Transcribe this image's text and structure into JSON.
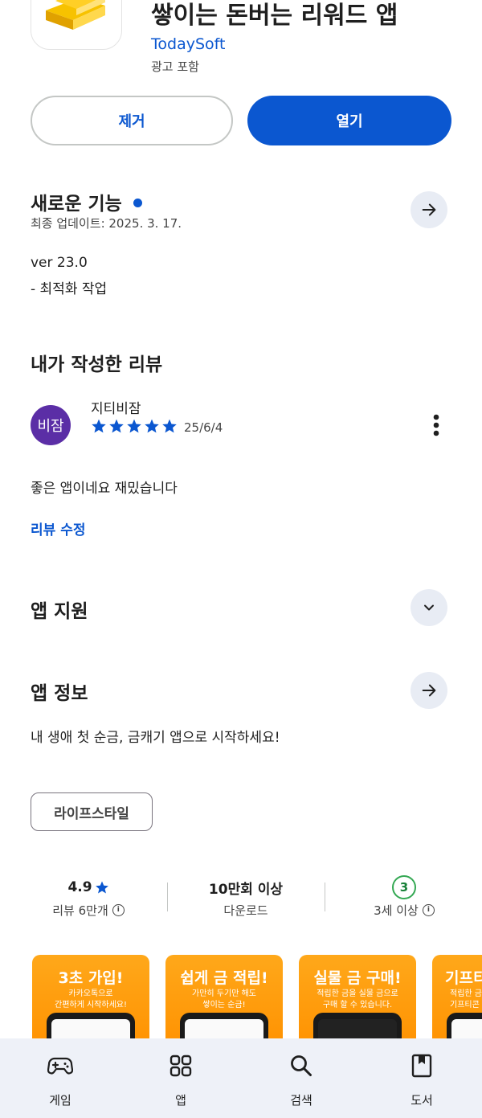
{
  "app": {
    "title": "쌓이는 돈버는 리워드 앱",
    "developer": "TodaySoft",
    "ads_note": "광고 포함",
    "remove_label": "제거",
    "open_label": "열기"
  },
  "whats_new": {
    "title": "새로운 기능",
    "updated": "최종 업데이트: 2025. 3. 17.",
    "version": "ver 23.0",
    "notes": "- 최적화 작업"
  },
  "my_review": {
    "section_title": "내가 작성한 리뷰",
    "avatar_text": "비잠",
    "reviewer": "지티비잠",
    "stars": 5,
    "date": "25/6/4",
    "text": "좋은 앱이네요 재밌습니다",
    "edit_label": "리뷰 수정"
  },
  "app_support": {
    "title": "앱 지원"
  },
  "app_info": {
    "title": "앱 정보",
    "description": "내 생애 첫 순금, 금캐기 앱으로 시작하세요!",
    "category_chip": "라이프스타일"
  },
  "stats": {
    "rating_value": "4.9",
    "rating_label": "리뷰 6만개",
    "downloads_value": "10만회 이상",
    "downloads_label": "다운로드",
    "age_value": "3",
    "age_label": "3세 이상"
  },
  "screenshots": [
    {
      "title": "3초 가입!",
      "line1": "카카오톡으로",
      "line2": "간편하게 시작하세요!"
    },
    {
      "title": "쉽게 금 적립!",
      "line1": "가만히 두기만 해도",
      "line2": "쌓이는 순금!"
    },
    {
      "title": "실물 금 구매!",
      "line1": "적립한 금을 실물 금으로",
      "line2": "구매 할 수 있습니다."
    },
    {
      "title": "기프티",
      "line1": "적립한 금",
      "line2": "기프티콘"
    }
  ],
  "bottom_nav": [
    {
      "label": "게임",
      "icon": "gamepad-icon"
    },
    {
      "label": "앱",
      "icon": "apps-grid-icon"
    },
    {
      "label": "검색",
      "icon": "search-icon"
    },
    {
      "label": "도서",
      "icon": "book-icon"
    }
  ],
  "colors": {
    "accent": "#0b57d0",
    "avatar": "#5b2ea6",
    "age_badge": "#34a853",
    "screenshot_bg": "#ff9f0f",
    "nav_bg": "#eef1f8"
  }
}
